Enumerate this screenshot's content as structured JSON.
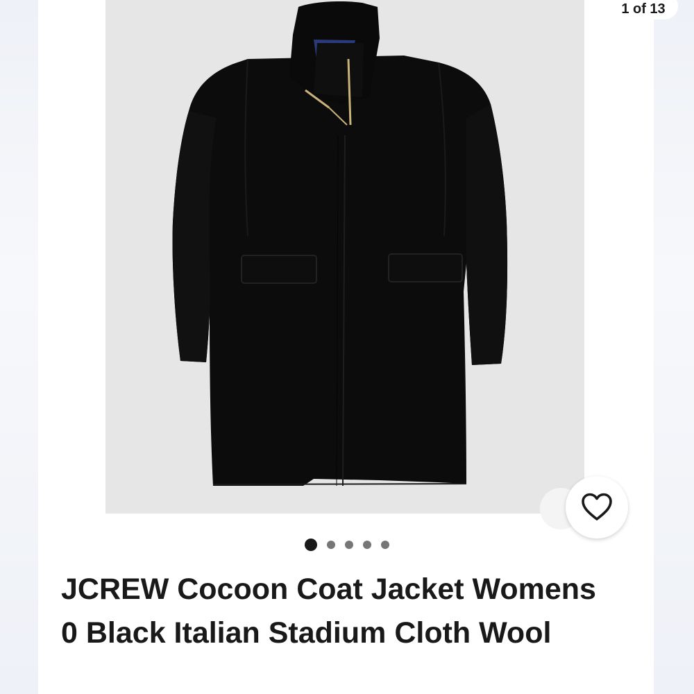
{
  "gallery": {
    "counter": "1 of 13",
    "photo_alt": "Black cocoon coat with stand collar and gold zipper",
    "dots_count": 5,
    "active_dot": 1
  },
  "favorite": {
    "icon": "heart-outline-icon"
  },
  "listing": {
    "title": "JCREW Cocoon Coat Jacket Womens 0 Black Italian Stadium Cloth Wool"
  },
  "colors": {
    "text": "#191919",
    "dot_inactive": "#767676",
    "photo_bg": "#e6e6e6",
    "coat": "#0c0c0c"
  }
}
